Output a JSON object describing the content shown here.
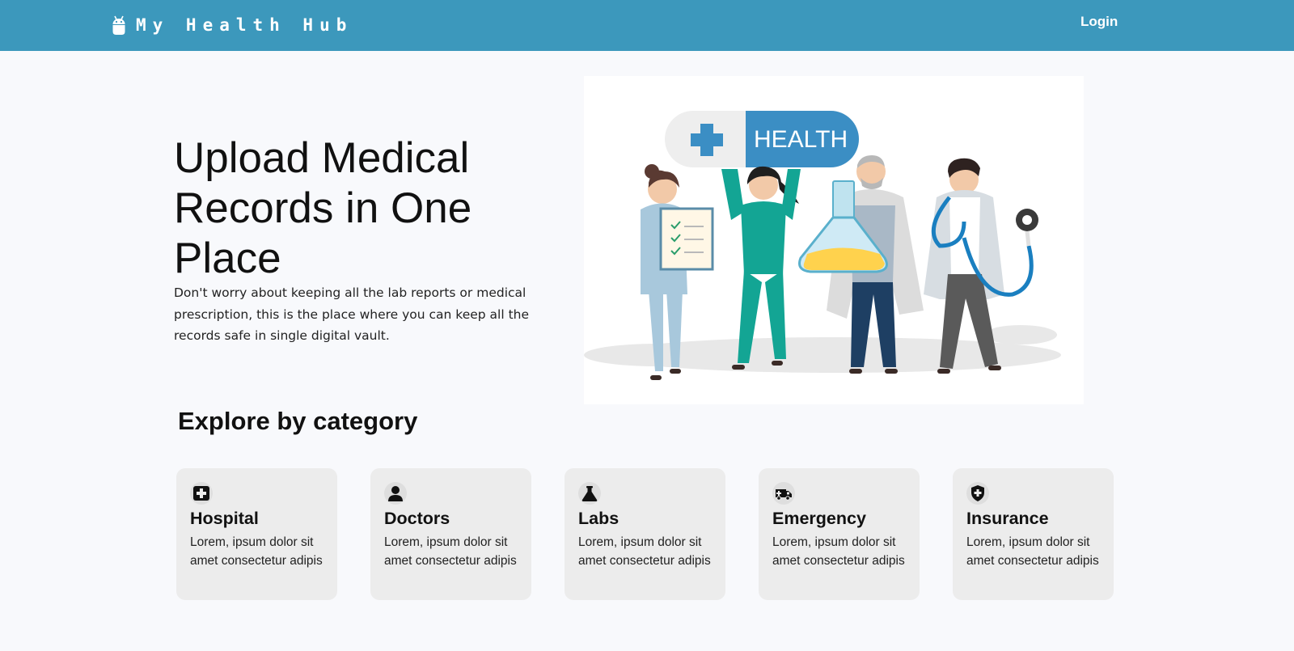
{
  "header": {
    "brand_name": "My Health Hub",
    "login_label": "Login",
    "background_color": "#3c98bc",
    "icon": "android-icon"
  },
  "hero": {
    "title": "Upload Medical Records in One Place",
    "description": "Don't worry about keeping all the lab reports or medical prescription, this is the place where you can keep all the records safe in single digital vault.",
    "image_sign_text": "HEALTH"
  },
  "categories_section": {
    "title": "Explore by category",
    "items": [
      {
        "label": "Hospital",
        "description": "Lorem, ipsum dolor sit amet consectetur adipis",
        "icon": "hospital-icon"
      },
      {
        "label": "Doctors",
        "description": "Lorem, ipsum dolor sit amet consectetur adipis",
        "icon": "doctor-icon"
      },
      {
        "label": "Labs",
        "description": "Lorem, ipsum dolor sit amet consectetur adipis",
        "icon": "flask-icon"
      },
      {
        "label": "Emergency",
        "description": "Lorem, ipsum dolor sit amet consectetur adipis",
        "icon": "ambulance-icon"
      },
      {
        "label": "Insurance",
        "description": "Lorem, ipsum dolor sit amet consectetur adipis",
        "icon": "shield-icon"
      }
    ]
  }
}
